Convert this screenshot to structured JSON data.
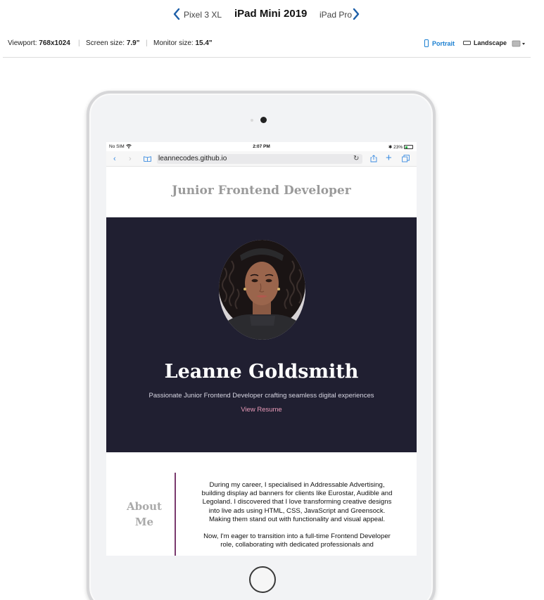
{
  "device_nav": {
    "prev_label": "Pixel 3 XL",
    "current_label": "iPad Mini 2019",
    "next_label": "iPad Pro"
  },
  "info_bar": {
    "viewport_label": "Viewport:",
    "viewport_value": "768x1024",
    "screen_size_label": "Screen size:",
    "screen_size_value": "7.9\"",
    "monitor_size_label": "Monitor size:",
    "monitor_size_value": "15.4\"",
    "portrait_label": "Portrait",
    "landscape_label": "Landscape"
  },
  "status_bar": {
    "carrier": "No SIM",
    "time": "2:07 PM",
    "battery": "23%"
  },
  "browser": {
    "url": "leannecodes.github.io"
  },
  "site": {
    "title": "Junior Frontend Developer",
    "hero": {
      "name": "Leanne Goldsmith",
      "tagline": "Passionate Junior Frontend Developer crafting seamless digital experiences",
      "cta": "View Resume"
    },
    "about": {
      "heading": "About Me",
      "paragraph_1": "During my career, I specialised in Addressable Advertising, building display ad banners for clients like Eurostar, Audible and Legoland. I discovered that I love transforming creative designs into live ads using HTML, CSS, JavaScript and Greensock. Making them stand out with functionality and visual appeal.",
      "paragraph_2": "Now, I'm eager to transition into a full-time Frontend Developer role, collaborating with dedicated professionals and"
    }
  },
  "colors": {
    "accent_blue": "#1a7fd1",
    "hero_bg": "#201f31",
    "link_pink": "#e89ab8",
    "about_rule": "#7a3a6e"
  }
}
